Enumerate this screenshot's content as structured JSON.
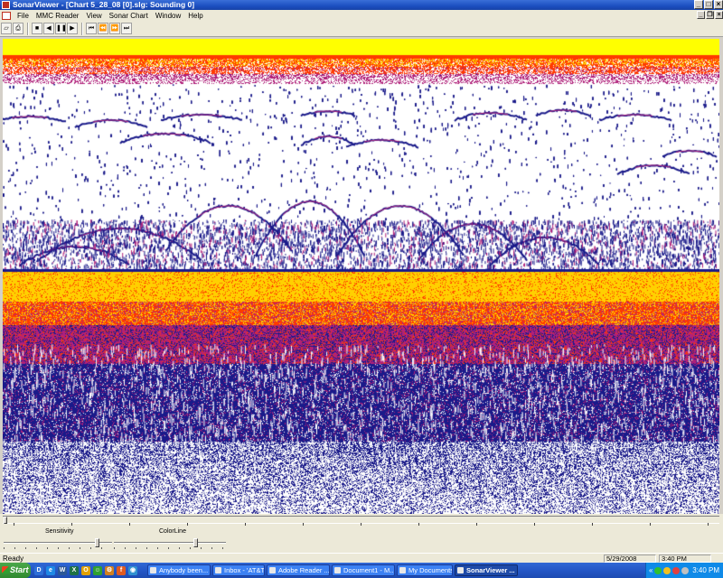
{
  "window": {
    "title": "SonarViewer - [Chart 5_28_08 [0].slg: Sounding 0]"
  },
  "menu": {
    "items": [
      "File",
      "MMC Reader",
      "View",
      "Sonar Chart",
      "Window",
      "Help"
    ]
  },
  "toolbar": {
    "buttons": [
      {
        "name": "open-icon",
        "glyph": "▱"
      },
      {
        "name": "print-icon",
        "glyph": "⎙"
      },
      {
        "name": "stop-icon",
        "glyph": "■"
      },
      {
        "name": "play-back-icon",
        "glyph": "◀"
      },
      {
        "name": "pause-icon",
        "glyph": "❚❚"
      },
      {
        "name": "play-icon",
        "glyph": "▶"
      },
      {
        "name": "skip-start-icon",
        "glyph": "⏮"
      },
      {
        "name": "rewind-icon",
        "glyph": "⏪"
      },
      {
        "name": "fast-forward-icon",
        "glyph": "⏩"
      },
      {
        "name": "skip-end-icon",
        "glyph": "⏭"
      }
    ]
  },
  "sonar": {
    "colors": {
      "surface": "#ffff00",
      "bottom_band": "#ffd000",
      "hot": "#ff3a00",
      "mid": "#b0207a",
      "weak": "#1a1a8a",
      "background": "#ffffff"
    },
    "surface_fraction": 0.06,
    "bottom_fraction": 0.49
  },
  "controls": {
    "sensitivity_label": "Sensitivity",
    "colorline_label": "ColorLine",
    "sensitivity_level": 0.88,
    "colorline_level": 0.74
  },
  "status": {
    "text": "Ready",
    "date": "5/29/2008",
    "time": "3:40 PM"
  },
  "taskbar": {
    "start_label": "Start",
    "quick_launch": [
      {
        "name": "desktop-icon",
        "color": "#2e6fd8",
        "glyph": "D"
      },
      {
        "name": "ie-icon",
        "color": "#1e88e5",
        "glyph": "e"
      },
      {
        "name": "word-icon",
        "color": "#2b5797",
        "glyph": "W"
      },
      {
        "name": "excel-icon",
        "color": "#1e7145",
        "glyph": "X"
      },
      {
        "name": "outlook-icon",
        "color": "#e0a000",
        "glyph": "O"
      },
      {
        "name": "messenger-icon",
        "color": "#30a030",
        "glyph": "☺"
      },
      {
        "name": "gear-icon",
        "color": "#d08020",
        "glyph": "⚙"
      },
      {
        "name": "firefox-icon",
        "color": "#e05a20",
        "glyph": "f"
      },
      {
        "name": "globe-icon",
        "color": "#3090d0",
        "glyph": "◉"
      }
    ],
    "tasks": [
      {
        "label": "Anybody been...",
        "active": false,
        "width": 70
      },
      {
        "label": "Inbox - 'AT&T ...",
        "active": false,
        "width": 58
      },
      {
        "label": "Adobe Reader ...",
        "active": false,
        "width": 70
      },
      {
        "label": "Document1 - M...",
        "active": false,
        "width": 70
      },
      {
        "label": "My Documents",
        "active": false,
        "width": 62
      },
      {
        "label": "SonarViewer ...",
        "active": true,
        "width": 70
      }
    ],
    "tray_clock": "3:40 PM"
  }
}
